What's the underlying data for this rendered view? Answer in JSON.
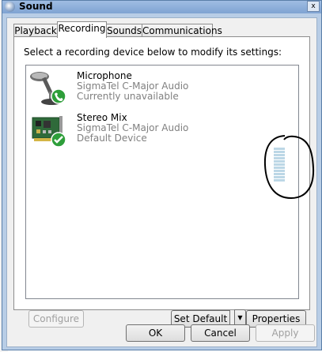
{
  "window": {
    "title": "Sound",
    "close_glyph": "x"
  },
  "tabs": [
    {
      "label": "Playback",
      "active": false
    },
    {
      "label": "Recording",
      "active": true
    },
    {
      "label": "Sounds",
      "active": false
    },
    {
      "label": "Communications",
      "active": false
    }
  ],
  "panel": {
    "instruction": "Select a recording device below to modify its settings:"
  },
  "devices": [
    {
      "name": "Microphone",
      "driver": "SigmaTel C-Major Audio",
      "status": "Currently unavailable",
      "icon": "microphone-icon",
      "badge": "phone-badge-icon"
    },
    {
      "name": "Stereo Mix",
      "driver": "SigmaTel C-Major Audio",
      "status": "Default Device",
      "icon": "sound-card-icon",
      "badge": "checkmark-badge-icon"
    }
  ],
  "level_meter": {
    "level": 0,
    "segments": 11
  },
  "buttons": {
    "configure": "Configure",
    "set_default": "Set Default",
    "properties": "Properties",
    "ok": "OK",
    "cancel": "Cancel",
    "apply": "Apply"
  },
  "colors": {
    "title_bar": "#8fb0db",
    "check_green": "#2e9e3a",
    "meter_idle": "#bcd7e6",
    "annotation_ink": "#000000"
  }
}
